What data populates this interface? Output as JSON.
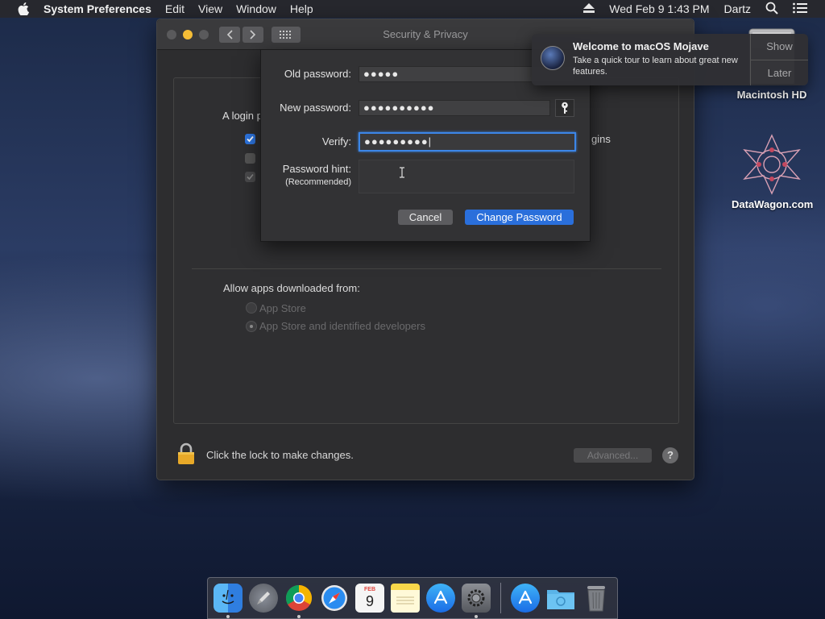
{
  "menubar": {
    "app_name": "System Preferences",
    "menus": [
      "Edit",
      "View",
      "Window",
      "Help"
    ],
    "clock": "Wed Feb 9  1:43 PM",
    "user": "Dartz"
  },
  "desktop": {
    "icons": [
      {
        "label": "Macintosh HD"
      },
      {
        "label": "DataWagon.com"
      }
    ]
  },
  "window": {
    "title": "Security & Privacy",
    "login_label": "A login p",
    "ins_text": "gins",
    "allow_label": "Allow apps downloaded from:",
    "radio_options": [
      "App Store",
      "App Store and identified developers"
    ],
    "lock_text": "Click the lock to make changes.",
    "advanced_label": "Advanced...",
    "help_label": "?"
  },
  "dialog": {
    "old_password_label": "Old password:",
    "old_password_value": "●●●●●",
    "new_password_label": "New password:",
    "new_password_value": "●●●●●●●●●●",
    "verify_label": "Verify:",
    "verify_value": "●●●●●●●●●|",
    "hint_label": "Password hint:",
    "hint_sublabel": "(Recommended)",
    "cancel_label": "Cancel",
    "change_label": "Change Password"
  },
  "notification": {
    "title": "Welcome to macOS Mojave",
    "body": "Take a quick tour to learn about great new features.",
    "show_label": "Show",
    "later_label": "Later"
  },
  "dock": {
    "apps": [
      "finder",
      "launchpad",
      "chrome",
      "safari",
      "calendar",
      "notes",
      "app-store",
      "system-preferences",
      "app-store-installer",
      "downloads",
      "trash"
    ],
    "calendar_month": "FEB",
    "calendar_day": "9"
  },
  "colors": {
    "accent": "#2a6fdb",
    "focus_ring": "#3c86e8",
    "minimize": "#f5bd36"
  }
}
